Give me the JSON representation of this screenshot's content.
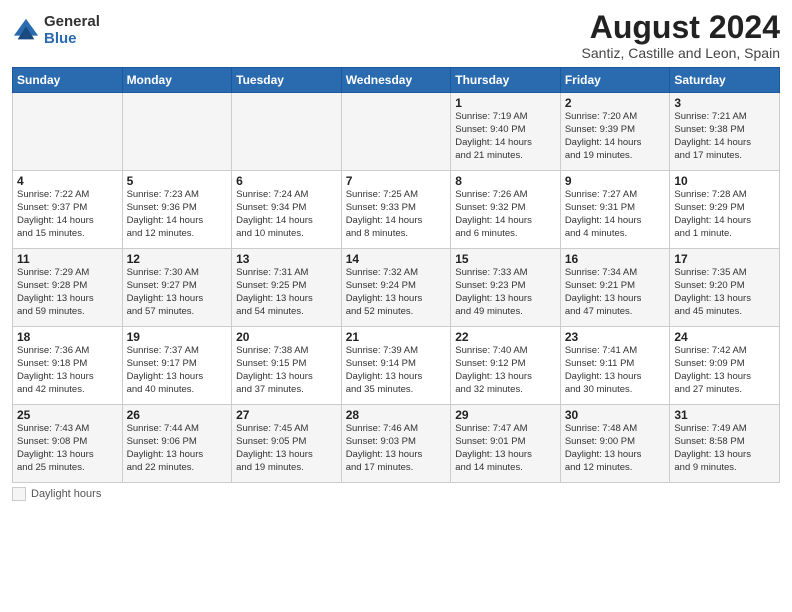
{
  "logo": {
    "general": "General",
    "blue": "Blue"
  },
  "title": "August 2024",
  "location": "Santiz, Castille and Leon, Spain",
  "days_header": [
    "Sunday",
    "Monday",
    "Tuesday",
    "Wednesday",
    "Thursday",
    "Friday",
    "Saturday"
  ],
  "legend": "Daylight hours",
  "weeks": [
    [
      {
        "day": "",
        "info": ""
      },
      {
        "day": "",
        "info": ""
      },
      {
        "day": "",
        "info": ""
      },
      {
        "day": "",
        "info": ""
      },
      {
        "day": "1",
        "info": "Sunrise: 7:19 AM\nSunset: 9:40 PM\nDaylight: 14 hours\nand 21 minutes."
      },
      {
        "day": "2",
        "info": "Sunrise: 7:20 AM\nSunset: 9:39 PM\nDaylight: 14 hours\nand 19 minutes."
      },
      {
        "day": "3",
        "info": "Sunrise: 7:21 AM\nSunset: 9:38 PM\nDaylight: 14 hours\nand 17 minutes."
      }
    ],
    [
      {
        "day": "4",
        "info": "Sunrise: 7:22 AM\nSunset: 9:37 PM\nDaylight: 14 hours\nand 15 minutes."
      },
      {
        "day": "5",
        "info": "Sunrise: 7:23 AM\nSunset: 9:36 PM\nDaylight: 14 hours\nand 12 minutes."
      },
      {
        "day": "6",
        "info": "Sunrise: 7:24 AM\nSunset: 9:34 PM\nDaylight: 14 hours\nand 10 minutes."
      },
      {
        "day": "7",
        "info": "Sunrise: 7:25 AM\nSunset: 9:33 PM\nDaylight: 14 hours\nand 8 minutes."
      },
      {
        "day": "8",
        "info": "Sunrise: 7:26 AM\nSunset: 9:32 PM\nDaylight: 14 hours\nand 6 minutes."
      },
      {
        "day": "9",
        "info": "Sunrise: 7:27 AM\nSunset: 9:31 PM\nDaylight: 14 hours\nand 4 minutes."
      },
      {
        "day": "10",
        "info": "Sunrise: 7:28 AM\nSunset: 9:29 PM\nDaylight: 14 hours\nand 1 minute."
      }
    ],
    [
      {
        "day": "11",
        "info": "Sunrise: 7:29 AM\nSunset: 9:28 PM\nDaylight: 13 hours\nand 59 minutes."
      },
      {
        "day": "12",
        "info": "Sunrise: 7:30 AM\nSunset: 9:27 PM\nDaylight: 13 hours\nand 57 minutes."
      },
      {
        "day": "13",
        "info": "Sunrise: 7:31 AM\nSunset: 9:25 PM\nDaylight: 13 hours\nand 54 minutes."
      },
      {
        "day": "14",
        "info": "Sunrise: 7:32 AM\nSunset: 9:24 PM\nDaylight: 13 hours\nand 52 minutes."
      },
      {
        "day": "15",
        "info": "Sunrise: 7:33 AM\nSunset: 9:23 PM\nDaylight: 13 hours\nand 49 minutes."
      },
      {
        "day": "16",
        "info": "Sunrise: 7:34 AM\nSunset: 9:21 PM\nDaylight: 13 hours\nand 47 minutes."
      },
      {
        "day": "17",
        "info": "Sunrise: 7:35 AM\nSunset: 9:20 PM\nDaylight: 13 hours\nand 45 minutes."
      }
    ],
    [
      {
        "day": "18",
        "info": "Sunrise: 7:36 AM\nSunset: 9:18 PM\nDaylight: 13 hours\nand 42 minutes."
      },
      {
        "day": "19",
        "info": "Sunrise: 7:37 AM\nSunset: 9:17 PM\nDaylight: 13 hours\nand 40 minutes."
      },
      {
        "day": "20",
        "info": "Sunrise: 7:38 AM\nSunset: 9:15 PM\nDaylight: 13 hours\nand 37 minutes."
      },
      {
        "day": "21",
        "info": "Sunrise: 7:39 AM\nSunset: 9:14 PM\nDaylight: 13 hours\nand 35 minutes."
      },
      {
        "day": "22",
        "info": "Sunrise: 7:40 AM\nSunset: 9:12 PM\nDaylight: 13 hours\nand 32 minutes."
      },
      {
        "day": "23",
        "info": "Sunrise: 7:41 AM\nSunset: 9:11 PM\nDaylight: 13 hours\nand 30 minutes."
      },
      {
        "day": "24",
        "info": "Sunrise: 7:42 AM\nSunset: 9:09 PM\nDaylight: 13 hours\nand 27 minutes."
      }
    ],
    [
      {
        "day": "25",
        "info": "Sunrise: 7:43 AM\nSunset: 9:08 PM\nDaylight: 13 hours\nand 25 minutes."
      },
      {
        "day": "26",
        "info": "Sunrise: 7:44 AM\nSunset: 9:06 PM\nDaylight: 13 hours\nand 22 minutes."
      },
      {
        "day": "27",
        "info": "Sunrise: 7:45 AM\nSunset: 9:05 PM\nDaylight: 13 hours\nand 19 minutes."
      },
      {
        "day": "28",
        "info": "Sunrise: 7:46 AM\nSunset: 9:03 PM\nDaylight: 13 hours\nand 17 minutes."
      },
      {
        "day": "29",
        "info": "Sunrise: 7:47 AM\nSunset: 9:01 PM\nDaylight: 13 hours\nand 14 minutes."
      },
      {
        "day": "30",
        "info": "Sunrise: 7:48 AM\nSunset: 9:00 PM\nDaylight: 13 hours\nand 12 minutes."
      },
      {
        "day": "31",
        "info": "Sunrise: 7:49 AM\nSunset: 8:58 PM\nDaylight: 13 hours\nand 9 minutes."
      }
    ]
  ]
}
